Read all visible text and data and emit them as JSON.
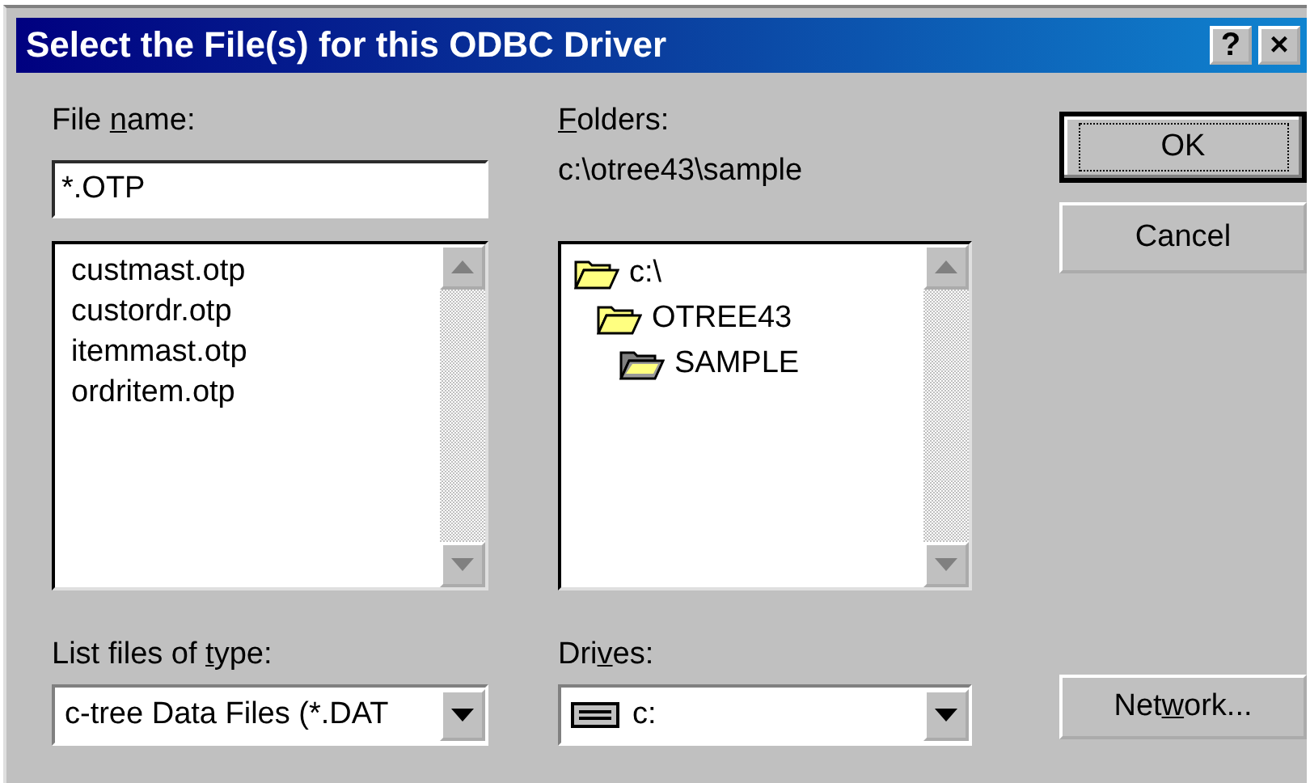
{
  "window": {
    "title": "Select the File(s) for this ODBC Driver",
    "title_buttons": [
      "?",
      "×"
    ]
  },
  "file_name": {
    "label": [
      {
        "text": "File ",
        "underlined": false
      },
      {
        "text": "n",
        "underlined": true
      },
      {
        "text": "ame:",
        "underlined": false
      }
    ],
    "value": "*.OTP"
  },
  "files": [
    "custmast.otp",
    "custordr.otp",
    "itemmast.otp",
    "ordritem.otp"
  ],
  "folders": {
    "label": [
      {
        "text": "F",
        "underlined": true
      },
      {
        "text": "olders:",
        "underlined": false
      }
    ],
    "path": "c:\\otree43\\sample",
    "tree": [
      {
        "name": "c:\\",
        "selected": false,
        "children": [
          {
            "name": "OTREE43",
            "selected": false,
            "children": [
              {
                "name": "SAMPLE",
                "selected": true
              }
            ]
          }
        ]
      }
    ]
  },
  "file_type": {
    "label": [
      {
        "text": "List files of ",
        "underlined": false
      },
      {
        "text": "t",
        "underlined": true
      },
      {
        "text": "ype:",
        "underlined": false
      }
    ],
    "value": "c-tree Data Files (*.DAT"
  },
  "drives": {
    "label": [
      {
        "text": "Dri",
        "underlined": false
      },
      {
        "text": "v",
        "underlined": true
      },
      {
        "text": "es:",
        "underlined": false
      }
    ],
    "value": "c:"
  },
  "buttons": [
    {
      "label": "OK",
      "default": true
    },
    {
      "label": "Cancel",
      "default": false
    }
  ],
  "network_button": {
    "label": [
      {
        "text": "Net",
        "underlined": false
      },
      {
        "text": "w",
        "underlined": true
      },
      {
        "text": "ork...",
        "underlined": false
      }
    ]
  }
}
